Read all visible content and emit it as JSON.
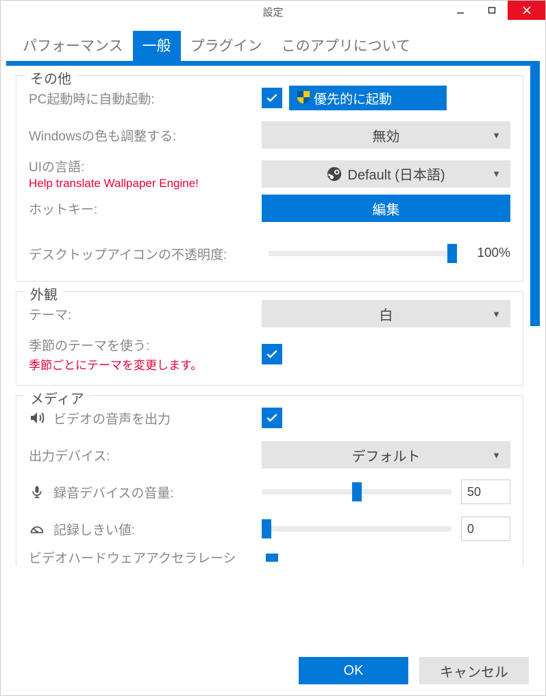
{
  "window": {
    "title": "設定"
  },
  "tabs": {
    "performance": "パフォーマンス",
    "general": "一般",
    "plugins": "プラグイン",
    "about": "このアプリについて"
  },
  "sections": {
    "other": {
      "legend": "その他",
      "autostart_label": "PC起動時に自動起動:",
      "autostart_priority": "優先的に起動",
      "windows_color_label": "Windowsの色も調整する:",
      "windows_color_value": "無効",
      "ui_lang_label": "UIの言語:",
      "ui_lang_help": "Help translate Wallpaper Engine!",
      "ui_lang_value": "Default (日本語)",
      "hotkey_label": "ホットキー:",
      "hotkey_btn": "編集",
      "icon_opacity_label": "デスクトップアイコンの不透明度:",
      "icon_opacity_value": "100%"
    },
    "appearance": {
      "legend": "外観",
      "theme_label": "テーマ:",
      "theme_value": "白",
      "seasonal_label": "季節のテーマを使う:",
      "seasonal_help": "季節ごとにテーマを変更します。"
    },
    "media": {
      "legend": "メディア",
      "video_audio_label": "ビデオの音声を出力",
      "output_device_label": "出力デバイス:",
      "output_device_value": "デフォルト",
      "rec_volume_label": "録音デバイスの音量:",
      "rec_volume_value": "50",
      "rec_threshold_label": "記録しきい値:",
      "rec_threshold_value": "0",
      "hw_accel_label": "ビデオハードウェアアクセラレーシ"
    }
  },
  "footer": {
    "ok": "OK",
    "cancel": "キャンセル"
  }
}
